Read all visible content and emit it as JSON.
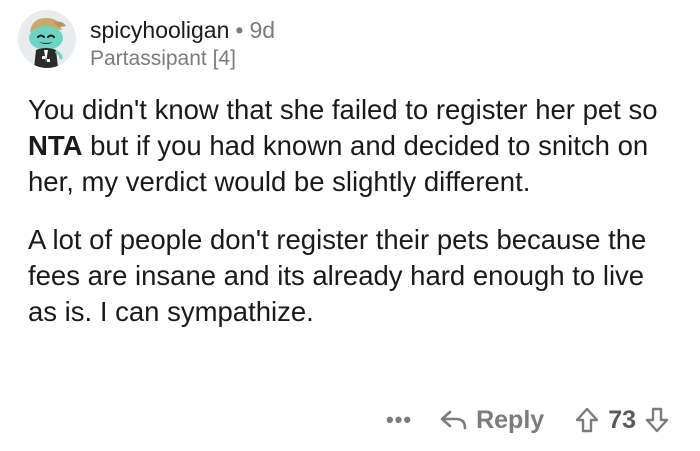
{
  "comment": {
    "author": {
      "username": "spicyhooligan",
      "separator": "•",
      "age": "9d",
      "flair": "Partassipant [4]"
    },
    "body": {
      "p1_part1": "You didn't know that she failed to register her pet so ",
      "p1_bold": "NTA",
      "p1_part2": " but if you had known and decided to snitch on her, my verdict would be slightly different.",
      "p2": "A lot of people don't register their pets because the fees are insane and its already hard enough to live as is. I can sympathize."
    },
    "actions": {
      "more_label": "•••",
      "reply_label": "Reply",
      "score": "73"
    },
    "colors": {
      "text": "#1a1a1b",
      "muted": "#7c7c7c",
      "avatar_bg": "#e8ecef",
      "avatar_face": "#6dd3c5"
    },
    "icons": {
      "avatar": "snoo-avatar-icon",
      "reply": "reply-arrow-icon",
      "upvote": "upvote-arrow-icon",
      "downvote": "downvote-arrow-icon"
    }
  }
}
